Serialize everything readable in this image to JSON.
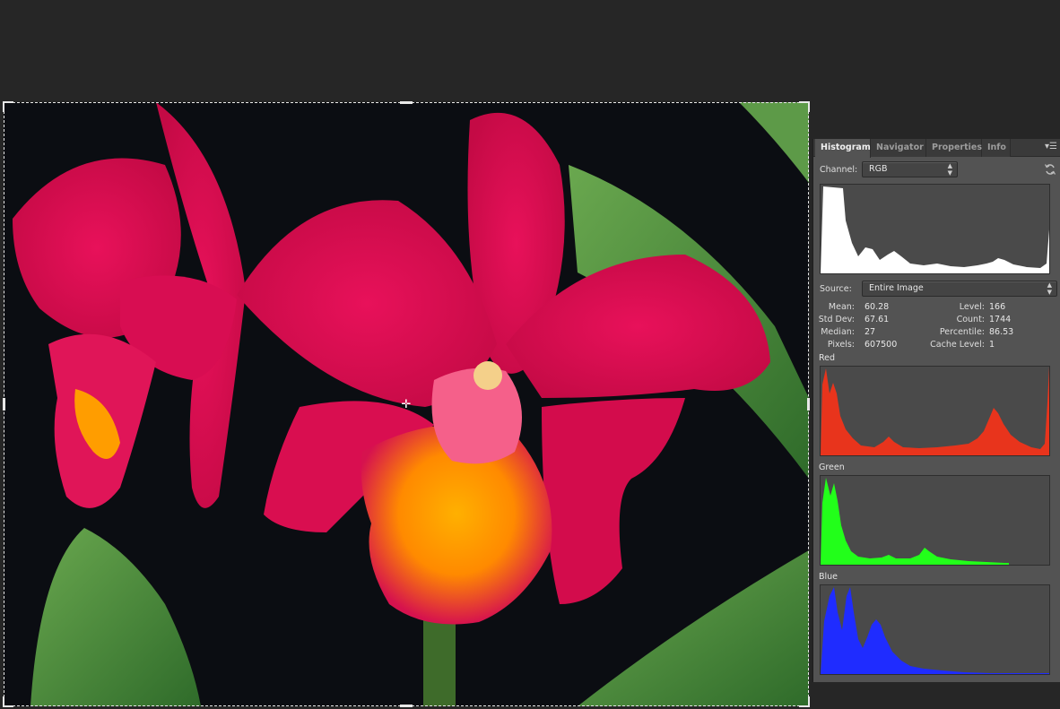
{
  "panel": {
    "tabs": [
      {
        "label": "Histogram",
        "active": true
      },
      {
        "label": "Navigator",
        "active": false
      },
      {
        "label": "Properties",
        "active": false
      },
      {
        "label": "Info",
        "active": false
      }
    ],
    "menu_icon": "panel-menu-icon",
    "channel": {
      "label": "Channel:",
      "value": "RGB"
    },
    "source": {
      "label": "Source:",
      "value": "Entire Image"
    },
    "refresh_icon": "refresh-icon",
    "stats_left": [
      {
        "key": "Mean:",
        "value": "60.28"
      },
      {
        "key": "Std Dev:",
        "value": "67.61"
      },
      {
        "key": "Median:",
        "value": "27"
      },
      {
        "key": "Pixels:",
        "value": "607500"
      }
    ],
    "stats_right": [
      {
        "key": "Level:",
        "value": "166"
      },
      {
        "key": "Count:",
        "value": "1744"
      },
      {
        "key": "Percentile:",
        "value": "86.53"
      },
      {
        "key": "Cache Level:",
        "value": "1"
      }
    ],
    "channels": [
      {
        "title": "Red",
        "color": "#e8341c"
      },
      {
        "title": "Green",
        "color": "#22ff1a"
      },
      {
        "title": "Blue",
        "color": "#1f2cff"
      }
    ],
    "rgb_color": "#ffffff"
  },
  "canvas": {
    "background": "#0b0d12",
    "cursor_icon": "crosshair-cursor-icon"
  }
}
